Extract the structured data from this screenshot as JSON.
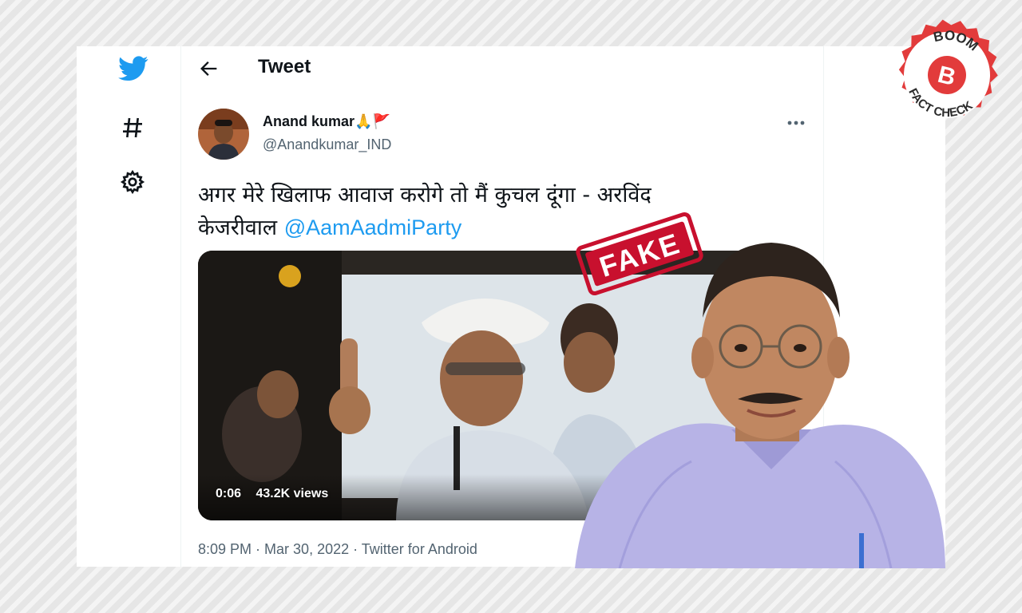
{
  "header": {
    "title": "Tweet"
  },
  "sidebar": {
    "icons": [
      "twitter-bird-icon",
      "hashtag-icon",
      "settings-gear-icon"
    ]
  },
  "tweet": {
    "display_name": "Anand kumar",
    "name_emojis": "🙏🚩",
    "handle": "@Anandkumar_IND",
    "text_line1": "अगर मेरे खिलाफ आवाज करोगे तो मैं कुचल दूंगा - अरविंद",
    "text_line2": "केजरीवाल",
    "mention": "@AamAadmiParty",
    "video": {
      "duration": "0:06",
      "views": "43.2K views"
    },
    "time": "8:09 PM",
    "date": "Mar 30, 2022",
    "source": "Twitter for Android",
    "separator": " · "
  },
  "overlay": {
    "stamp_text": "FAKE",
    "badge_top": "BOOM",
    "badge_letter": "B",
    "badge_bottom": "FACT CHECK"
  },
  "colors": {
    "twitter_blue": "#1d9bf0",
    "text_primary": "#0f1419",
    "text_secondary": "#536471",
    "stamp_red": "#c8102e",
    "boom_red": "#e23b3b"
  }
}
